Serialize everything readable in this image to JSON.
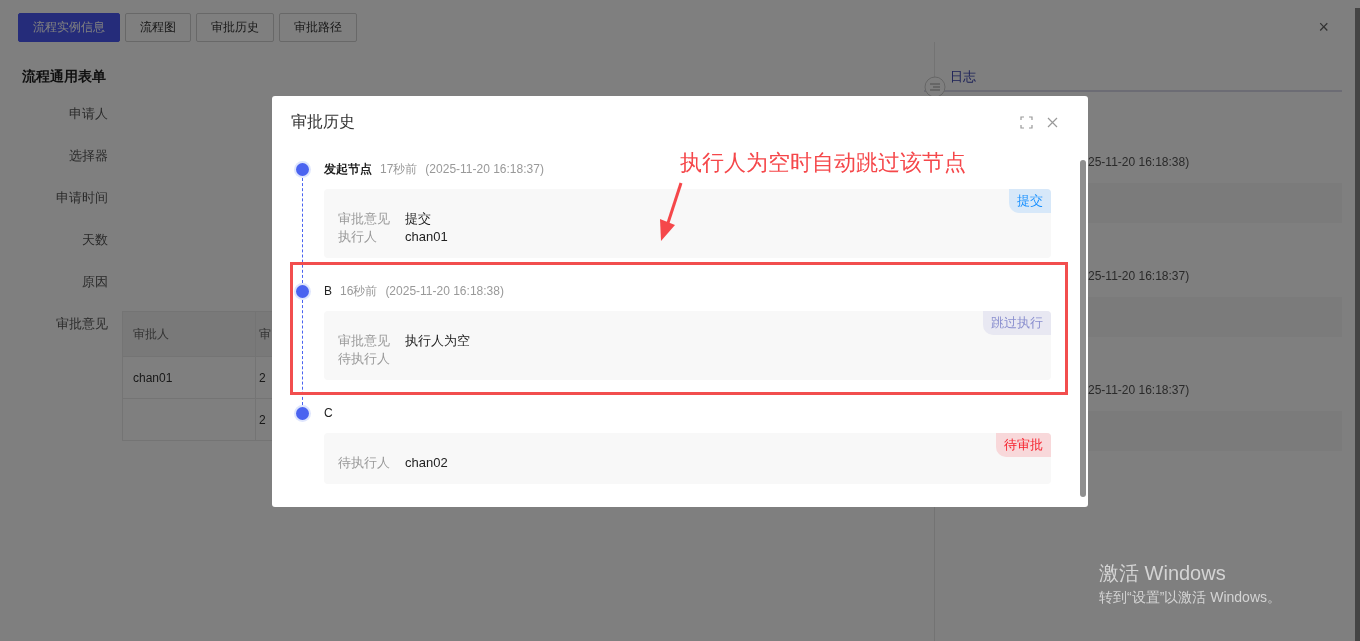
{
  "top_tabs": [
    {
      "label": "流程实例信息",
      "selected": true
    },
    {
      "label": "流程图",
      "selected": false
    },
    {
      "label": "审批历史",
      "selected": false
    },
    {
      "label": "审批路径",
      "selected": false
    }
  ],
  "close_symbol": "×",
  "form": {
    "title": "流程通用表单",
    "fields": [
      "申请人",
      "选择器",
      "申请时间",
      "天数",
      "原因",
      "审批意见"
    ],
    "table": {
      "columns": [
        "审批人",
        "审"
      ],
      "rows": [
        {
          "approver": "chan01",
          "column_2": "2"
        },
        {
          "column_2": "2"
        }
      ]
    }
  },
  "log_panel": {
    "tab": "日志",
    "entries": [
      {
        "time": "25-11-20 16:18:38)"
      },
      {
        "time": "25-11-20 16:18:37)"
      },
      {
        "time": "25-11-20 16:18:37)"
      }
    ]
  },
  "dialog": {
    "title": "审批历史",
    "annotation": "执行人为空时自动跳过该节点",
    "nodes": [
      {
        "name": "发起节点",
        "bold": true,
        "relative_time": "17秒前",
        "timestamp": "(2025-11-20 16:18:37)",
        "highlighted": false,
        "status": "提交",
        "color": "#1890ff",
        "fields": [
          {
            "label": "审批意见",
            "value": "提交"
          },
          {
            "label": "执行人",
            "value": "chan01"
          }
        ]
      },
      {
        "name": "B",
        "bold": false,
        "relative_time": "16秒前",
        "timestamp": "(2025-11-20 16:18:38)",
        "highlighted": true,
        "status": "跳过执行",
        "color": "#8a8fcf",
        "fields": [
          {
            "label": "审批意见",
            "value": "执行人为空"
          },
          {
            "label": "待执行人"
          }
        ]
      },
      {
        "name": "C",
        "bold": false,
        "highlighted": false,
        "status": "待审批",
        "color": "#f5222d",
        "fields": [
          {
            "label": "待执行人",
            "value": "chan02"
          }
        ]
      }
    ]
  },
  "os_notice": {
    "title": "激活 Windows",
    "message": "转到“设置”以激活 Windows。"
  }
}
